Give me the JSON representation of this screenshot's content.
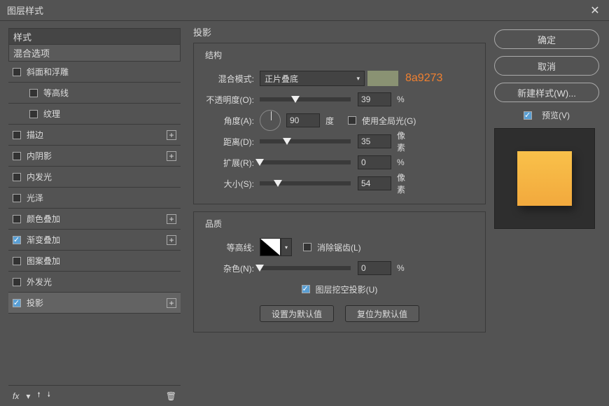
{
  "titlebar": {
    "title": "图层样式",
    "close": "✕"
  },
  "left": {
    "styles_header": "样式",
    "blend_header": "混合选项",
    "items": [
      {
        "label": "斜面和浮雕",
        "checked": false,
        "plus": false,
        "child": false
      },
      {
        "label": "等高线",
        "checked": false,
        "plus": false,
        "child": true
      },
      {
        "label": "纹理",
        "checked": false,
        "plus": false,
        "child": true
      },
      {
        "label": "描边",
        "checked": false,
        "plus": true,
        "child": false
      },
      {
        "label": "内阴影",
        "checked": false,
        "plus": true,
        "child": false
      },
      {
        "label": "内发光",
        "checked": false,
        "plus": false,
        "child": false
      },
      {
        "label": "光泽",
        "checked": false,
        "plus": false,
        "child": false
      },
      {
        "label": "颜色叠加",
        "checked": false,
        "plus": true,
        "child": false
      },
      {
        "label": "渐变叠加",
        "checked": true,
        "plus": true,
        "child": false
      },
      {
        "label": "图案叠加",
        "checked": false,
        "plus": false,
        "child": false
      },
      {
        "label": "外发光",
        "checked": false,
        "plus": false,
        "child": false
      },
      {
        "label": "投影",
        "checked": true,
        "plus": true,
        "child": false,
        "selected": true
      }
    ],
    "fx_icon": "fx"
  },
  "center": {
    "title": "投影",
    "group1": "结构",
    "blend_mode_label": "混合模式:",
    "blend_mode_value": "正片叠底",
    "color_hex": "8a9273",
    "swatch_color": "#8a9273",
    "opacity_label": "不透明度(O):",
    "opacity_value": "39",
    "opacity_unit": "%",
    "angle_label": "角度(A):",
    "angle_value": "90",
    "angle_unit": "度",
    "global_light_label": "使用全局光(G)",
    "distance_label": "距离(D):",
    "distance_value": "35",
    "distance_unit": "像素",
    "spread_label": "扩展(R):",
    "spread_value": "0",
    "spread_unit": "%",
    "size_label": "大小(S):",
    "size_value": "54",
    "size_unit": "像素",
    "group2": "品质",
    "contour_label": "等高线:",
    "antialias_label": "消除锯齿(L)",
    "noise_label": "杂色(N):",
    "noise_value": "0",
    "noise_unit": "%",
    "knockout_label": "图层挖空投影(U)",
    "make_default": "设置为默认值",
    "reset_default": "复位为默认值"
  },
  "right": {
    "ok": "确定",
    "cancel": "取消",
    "new_style": "新建样式(W)...",
    "preview": "预览(V)"
  }
}
